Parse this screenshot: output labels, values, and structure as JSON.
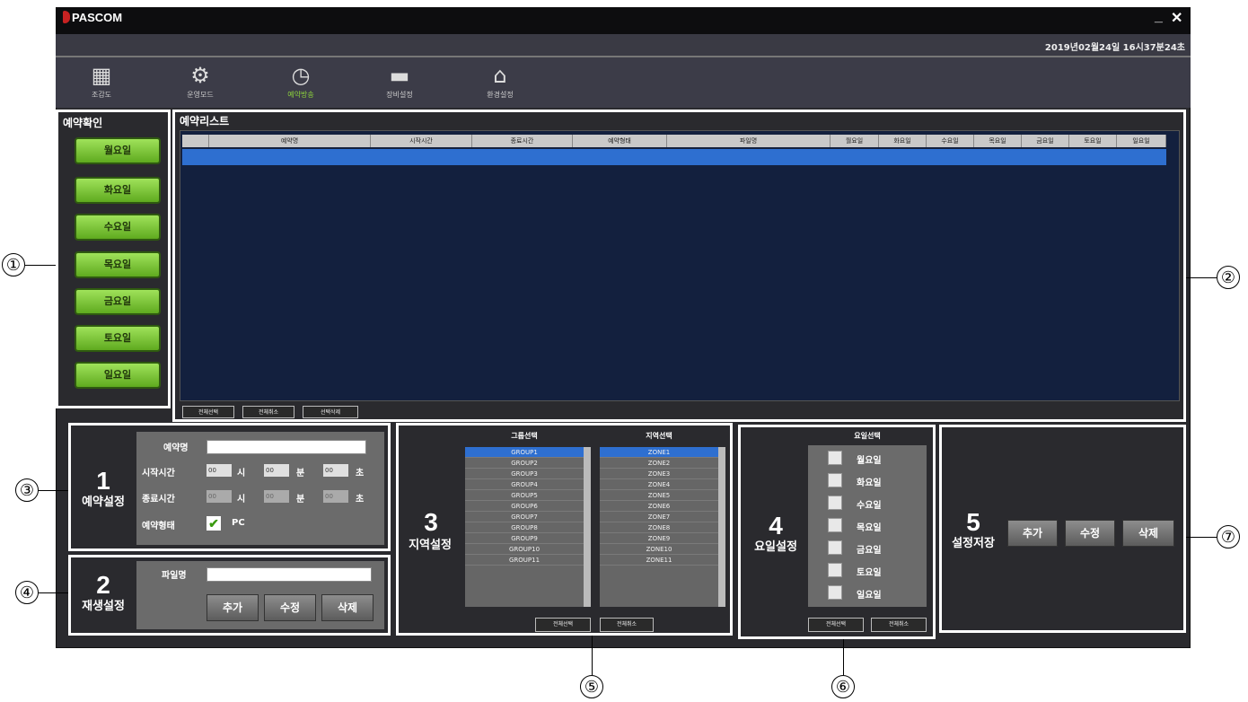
{
  "app": {
    "title": "PASCOM",
    "minimize": "_",
    "close": "✕",
    "clock": "2019년02월24일 16시37분24초"
  },
  "toolbar": [
    {
      "label": "조감도",
      "icon": "building-icon"
    },
    {
      "label": "운영모드",
      "icon": "gear-icon"
    },
    {
      "label": "예약방송",
      "icon": "clock-icon",
      "active": true
    },
    {
      "label": "장비설정",
      "icon": "computer-icon"
    },
    {
      "label": "환경설정",
      "icon": "home-icon"
    }
  ],
  "reserve_check": {
    "title": "예약확인",
    "days": [
      "월요일",
      "화요일",
      "수요일",
      "목요일",
      "금요일",
      "토요일",
      "일요일"
    ]
  },
  "reserve_list": {
    "title": "예약리스트",
    "columns": [
      "예약명",
      "시작시간",
      "종료시간",
      "예약형태",
      "파일명",
      "월요일",
      "화요일",
      "수요일",
      "목요일",
      "금요일",
      "토요일",
      "일요일"
    ],
    "buttons": [
      "전체선택",
      "전체취소",
      "선택삭제"
    ]
  },
  "sec1": {
    "num": "1",
    "title": "예약설정",
    "name_label": "예약명",
    "name_value": "",
    "start_label": "시작시간",
    "end_label": "종료시간",
    "type_label": "예약형태",
    "hour": "00",
    "min": "00",
    "sec": "00",
    "h_unit": "시",
    "m_unit": "분",
    "s_unit": "초",
    "type_value": "PC",
    "type_checked": true
  },
  "sec2": {
    "num": "2",
    "title": "재생설정",
    "file_label": "파일명",
    "file_value": "",
    "buttons": [
      "추가",
      "수정",
      "삭제"
    ]
  },
  "sec3": {
    "num": "3",
    "title": "지역설정",
    "group_header": "그룹선택",
    "zone_header": "지역선택",
    "groups": [
      "GROUP1",
      "GROUP2",
      "GROUP3",
      "GROUP4",
      "GROUP5",
      "GROUP6",
      "GROUP7",
      "GROUP8",
      "GROUP9",
      "GROUP10",
      "GROUP11"
    ],
    "zones": [
      "ZONE1",
      "ZONE2",
      "ZONE3",
      "ZONE4",
      "ZONE5",
      "ZONE6",
      "ZONE7",
      "ZONE8",
      "ZONE9",
      "ZONE10",
      "ZONE11"
    ],
    "buttons": [
      "전체선택",
      "전체취소"
    ]
  },
  "sec4": {
    "num": "4",
    "title": "요일설정",
    "header": "요일선택",
    "days": [
      "월요일",
      "화요일",
      "수요일",
      "목요일",
      "금요일",
      "토요일",
      "일요일"
    ],
    "buttons": [
      "전체선택",
      "전체취소"
    ]
  },
  "sec5": {
    "num": "5",
    "title": "설정저장",
    "buttons": [
      "추가",
      "수정",
      "삭제"
    ]
  },
  "callouts": [
    "①",
    "②",
    "③",
    "④",
    "⑤",
    "⑥",
    "⑦"
  ]
}
